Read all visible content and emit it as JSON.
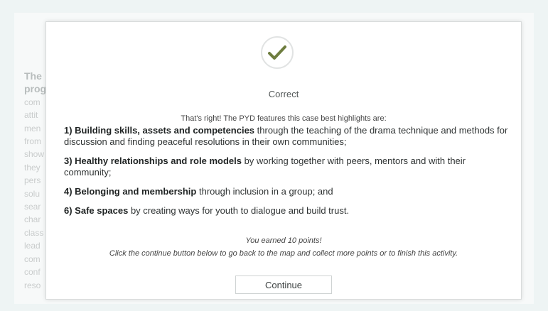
{
  "background": {
    "text_fragments": [
      "The",
      "prog",
      "com",
      "attit",
      "men",
      "from",
      "show",
      "they",
      "pers",
      "solu",
      "sear",
      "char",
      "class",
      "lead",
      "com",
      "conf",
      "reso"
    ]
  },
  "modal": {
    "icon": "check-icon",
    "accent_color": "#6e7d3f",
    "status": "Correct",
    "intro": "That's right! The PYD features this case best highlights are:",
    "items": [
      {
        "bold": "1) Building skills, assets and competencies",
        "rest": " through the teaching of the drama technique and methods for discussion and finding peaceful resolutions in their own communities;"
      },
      {
        "bold": "3) Healthy relationships and role models",
        "rest": " by working together with peers, mentors and with their community;"
      },
      {
        "bold": "4) Belonging and membership",
        "rest": " through inclusion in a group; and"
      },
      {
        "bold": "6) Safe spaces",
        "rest": " by creating ways for youth to dialogue and build trust."
      }
    ],
    "earned": "You earned 10 points!",
    "instruction": "Click the continue button below to go back to the map and collect more points or to finish this activity.",
    "continue_label": "Continue"
  }
}
